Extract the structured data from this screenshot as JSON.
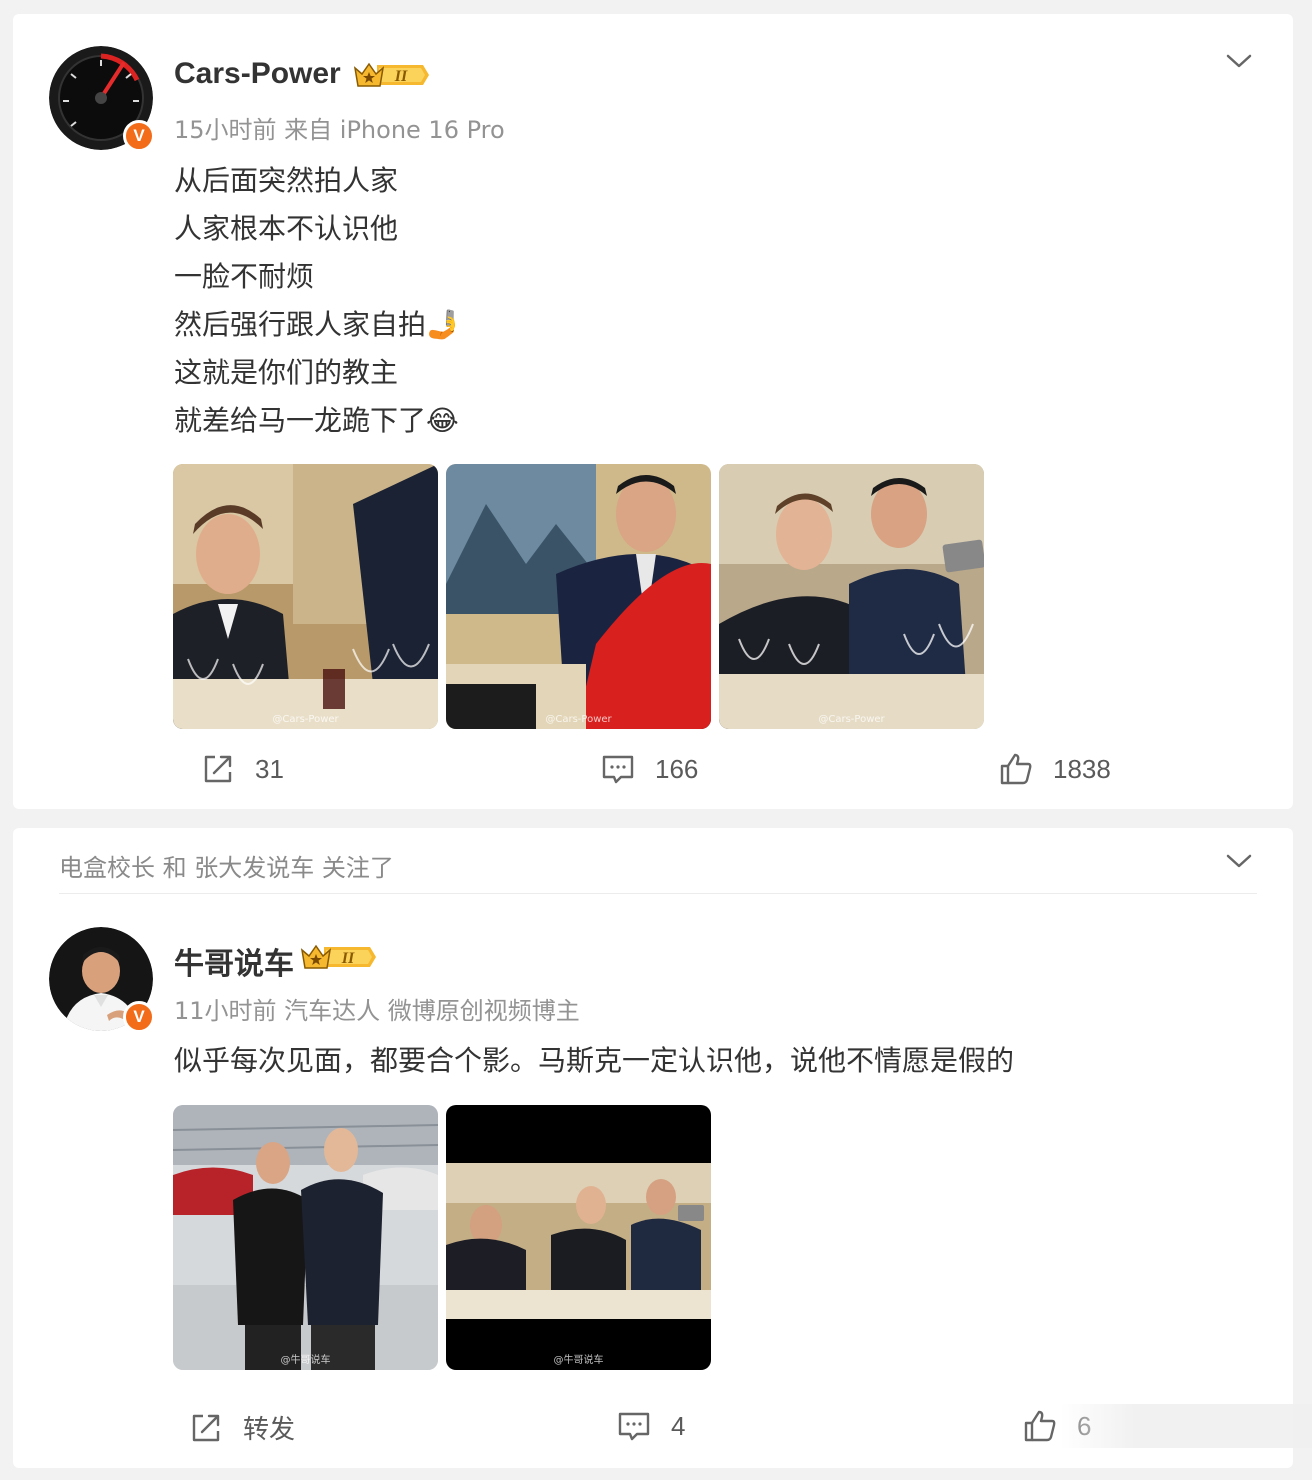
{
  "posts": [
    {
      "username": "Cars-Power",
      "vip_level": "II",
      "meta": "15小时前  来自 iPhone 16 Pro",
      "lines": [
        "从后面突然拍人家",
        "人家根本不认识他",
        "一脸不耐烦",
        "然后强行跟人家自拍🤳",
        "这就是你们的教主",
        "就差给马一龙跪下了😂"
      ],
      "images": [
        {
          "watermark": "@Cars-Power"
        },
        {
          "watermark": "@Cars-Power"
        },
        {
          "watermark": "@Cars-Power"
        }
      ],
      "repost_count": "31",
      "comment_count": "166",
      "like_count": "1838"
    },
    {
      "follow_note": "电盒校长 和 张大发说车 关注了",
      "username": "牛哥说车",
      "vip_level": "II",
      "meta": "11小时前  汽车达人 微博原创视频博主",
      "text": "似乎每次见面，都要合个影。马斯克一定认识他，说他不情愿是假的",
      "images": [
        {
          "watermark": "@牛哥说车"
        },
        {
          "watermark": "@牛哥说车"
        }
      ],
      "repost_label": "转发",
      "comment_count": "4",
      "like_count": "6"
    }
  ],
  "icons": {
    "repost": "share-icon",
    "comment": "comment-icon",
    "like": "thumbs-up-icon",
    "more": "chevron-down-icon",
    "verified": "verified-v-icon"
  },
  "colors": {
    "verified_badge": "#f26c1a",
    "vip_gold": "#f5b82e",
    "meta_gray": "#939393",
    "background": "#f2f2f2"
  }
}
